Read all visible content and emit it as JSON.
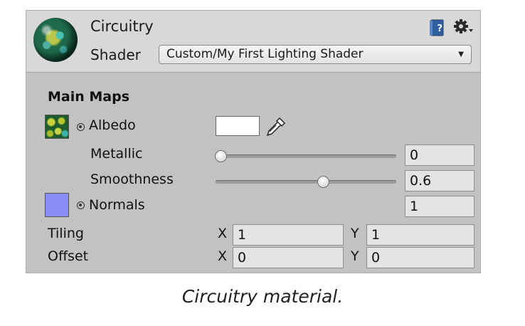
{
  "material": {
    "name": "Circuitry",
    "shader_label": "Shader",
    "shader_value": "Custom/My First Lighting Shader",
    "icons": [
      "material-sphere-preview",
      "help-book-icon",
      "gear-icon"
    ]
  },
  "main_maps": {
    "heading": "Main Maps",
    "albedo": {
      "label": "Albedo",
      "color": "#ffffff"
    },
    "metallic": {
      "label": "Metallic",
      "value": "0",
      "slider_fraction": 0
    },
    "smoothness": {
      "label": "Smoothness",
      "value": "0.6",
      "slider_fraction": 0.6
    },
    "normals": {
      "label": "Normals",
      "value": "1",
      "thumb_color": "#8a8cf5"
    },
    "tiling": {
      "label": "Tiling",
      "x_label": "X",
      "x": "1",
      "y_label": "Y",
      "y": "1"
    },
    "offset": {
      "label": "Offset",
      "x_label": "X",
      "x": "0",
      "y_label": "Y",
      "y": "0"
    }
  },
  "caption": "Circuitry material."
}
